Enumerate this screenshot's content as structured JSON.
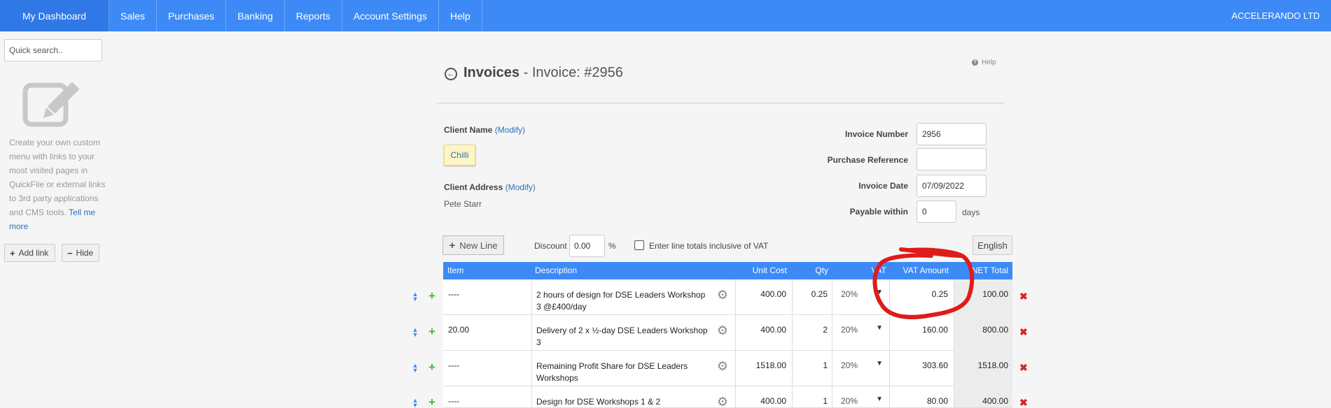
{
  "nav": {
    "items": [
      "My Dashboard",
      "Sales",
      "Purchases",
      "Banking",
      "Reports",
      "Account Settings",
      "Help"
    ],
    "company": "ACCELERANDO LTD"
  },
  "sidebar": {
    "search_placeholder": "Quick search..",
    "help_text": "Create your own custom menu with links to your most visited pages in QuickFile or external links to 3rd party applications and CMS tools.",
    "tell_more": "Tell me more",
    "add_link": "Add link",
    "hide": "Hide"
  },
  "header": {
    "section": "Invoices",
    "separator": " - ",
    "subtitle": "Invoice: #2956",
    "help": "Help"
  },
  "client": {
    "name_label": "Client Name",
    "modify": "(Modify)",
    "name": "Chilli",
    "address_label": "Client Address",
    "address": "Pete Starr"
  },
  "meta": {
    "invoice_number_label": "Invoice Number",
    "invoice_number": "2956",
    "purchase_ref_label": "Purchase Reference",
    "purchase_ref": "",
    "invoice_date_label": "Invoice Date",
    "invoice_date": "07/09/2022",
    "payable_label": "Payable within",
    "payable": "0",
    "days": "days"
  },
  "toolbar": {
    "new_line": "New Line",
    "discount_label": "Discount",
    "discount": "0.00",
    "percent": "%",
    "inclusive_label": "Enter line totals inclusive of VAT",
    "language": "English"
  },
  "table": {
    "headers": [
      "Item",
      "Description",
      "Unit Cost",
      "Qty",
      "VAT",
      "VAT Amount",
      "NET Total"
    ],
    "rows": [
      {
        "item": "----",
        "description": "2 hours of design for DSE Leaders Workshop 3 @£400/day",
        "unit_cost": "400.00",
        "qty": "0.25",
        "vat": "20%",
        "vat_amount": "0.25",
        "net_total": "100.00"
      },
      {
        "item": "20.00",
        "description": "Delivery of 2 x ½-day DSE Leaders Workshop 3",
        "unit_cost": "400.00",
        "qty": "2",
        "vat": "20%",
        "vat_amount": "160.00",
        "net_total": "800.00"
      },
      {
        "item": "----",
        "description": "Remaining Profit Share for DSE Leaders Workshops",
        "unit_cost": "1518.00",
        "qty": "1",
        "vat": "20%",
        "vat_amount": "303.60",
        "net_total": "1518.00"
      },
      {
        "item": "----",
        "description": "Design for DSE Workshops 1 & 2",
        "unit_cost": "400.00",
        "qty": "1",
        "vat": "20%",
        "vat_amount": "80.00",
        "net_total": "400.00"
      }
    ]
  },
  "colors": {
    "nav_blue": "#3d8af7",
    "annotation_red": "#e01b1b"
  }
}
